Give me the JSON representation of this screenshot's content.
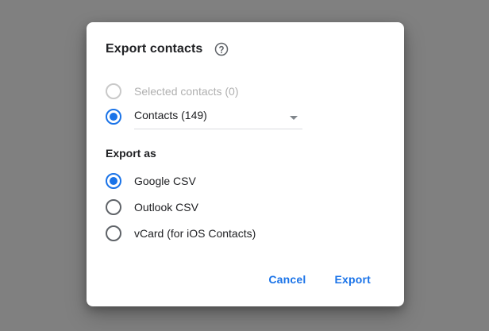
{
  "dialog": {
    "title": "Export contacts",
    "help_icon": "help-circle-icon"
  },
  "source": {
    "options": [
      {
        "label": "Selected contacts (0)",
        "checked": false,
        "disabled": true
      },
      {
        "label": "Contacts (149)",
        "checked": true,
        "disabled": false
      }
    ]
  },
  "export_as": {
    "label": "Export as",
    "options": [
      {
        "label": "Google CSV",
        "checked": true
      },
      {
        "label": "Outlook CSV",
        "checked": false
      },
      {
        "label": "vCard (for iOS Contacts)",
        "checked": false
      }
    ]
  },
  "actions": {
    "cancel_label": "Cancel",
    "export_label": "Export"
  },
  "colors": {
    "accent": "#1a73e8",
    "backdrop": "#808080"
  }
}
